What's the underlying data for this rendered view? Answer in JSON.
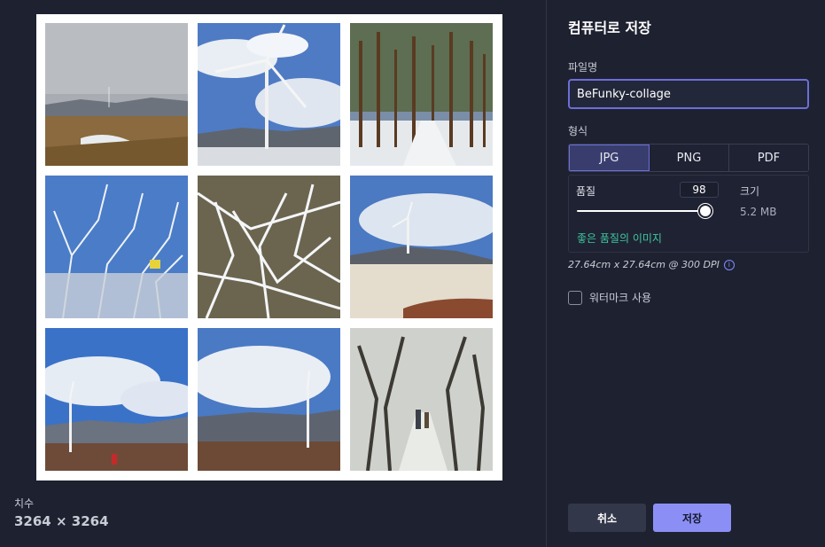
{
  "dimensions": {
    "label": "치수",
    "value": "3264 × 3264"
  },
  "panel": {
    "title": "컴퓨터로 저장",
    "filename_label": "파일명",
    "filename_value": "BeFunky-collage",
    "format_label": "형식",
    "formats": [
      "JPG",
      "PNG",
      "PDF"
    ],
    "selected_format": "JPG",
    "quality_label": "품질",
    "quality_value": "98",
    "quality_percent": 98,
    "size_label": "크기",
    "size_value": "5.2 MB",
    "quality_note": "좋은 품질의 이미지",
    "dpi_info": "27.64cm x 27.64cm @ 300 DPI",
    "watermark_label": "워터마크 사용",
    "watermark_checked": false,
    "cancel_label": "취소",
    "save_label": "저장"
  },
  "collage": {
    "tiles": [
      {
        "scene": "cloudy-hills-grass"
      },
      {
        "scene": "wind-turbine-closeup"
      },
      {
        "scene": "snowy-forest-trees"
      },
      {
        "scene": "frosted-branches-sign"
      },
      {
        "scene": "frosted-branches-closeup"
      },
      {
        "scene": "hilltop-turbine-snow"
      },
      {
        "scene": "turbine-hiker-blue-sky"
      },
      {
        "scene": "turbine-mountains-clouds"
      },
      {
        "scene": "snowy-path-hikers"
      }
    ]
  },
  "colors": {
    "accent": "#6b6fd6",
    "save_button": "#8b8ff5",
    "quality_note": "#3ec9a0",
    "background": "#1e2130"
  }
}
